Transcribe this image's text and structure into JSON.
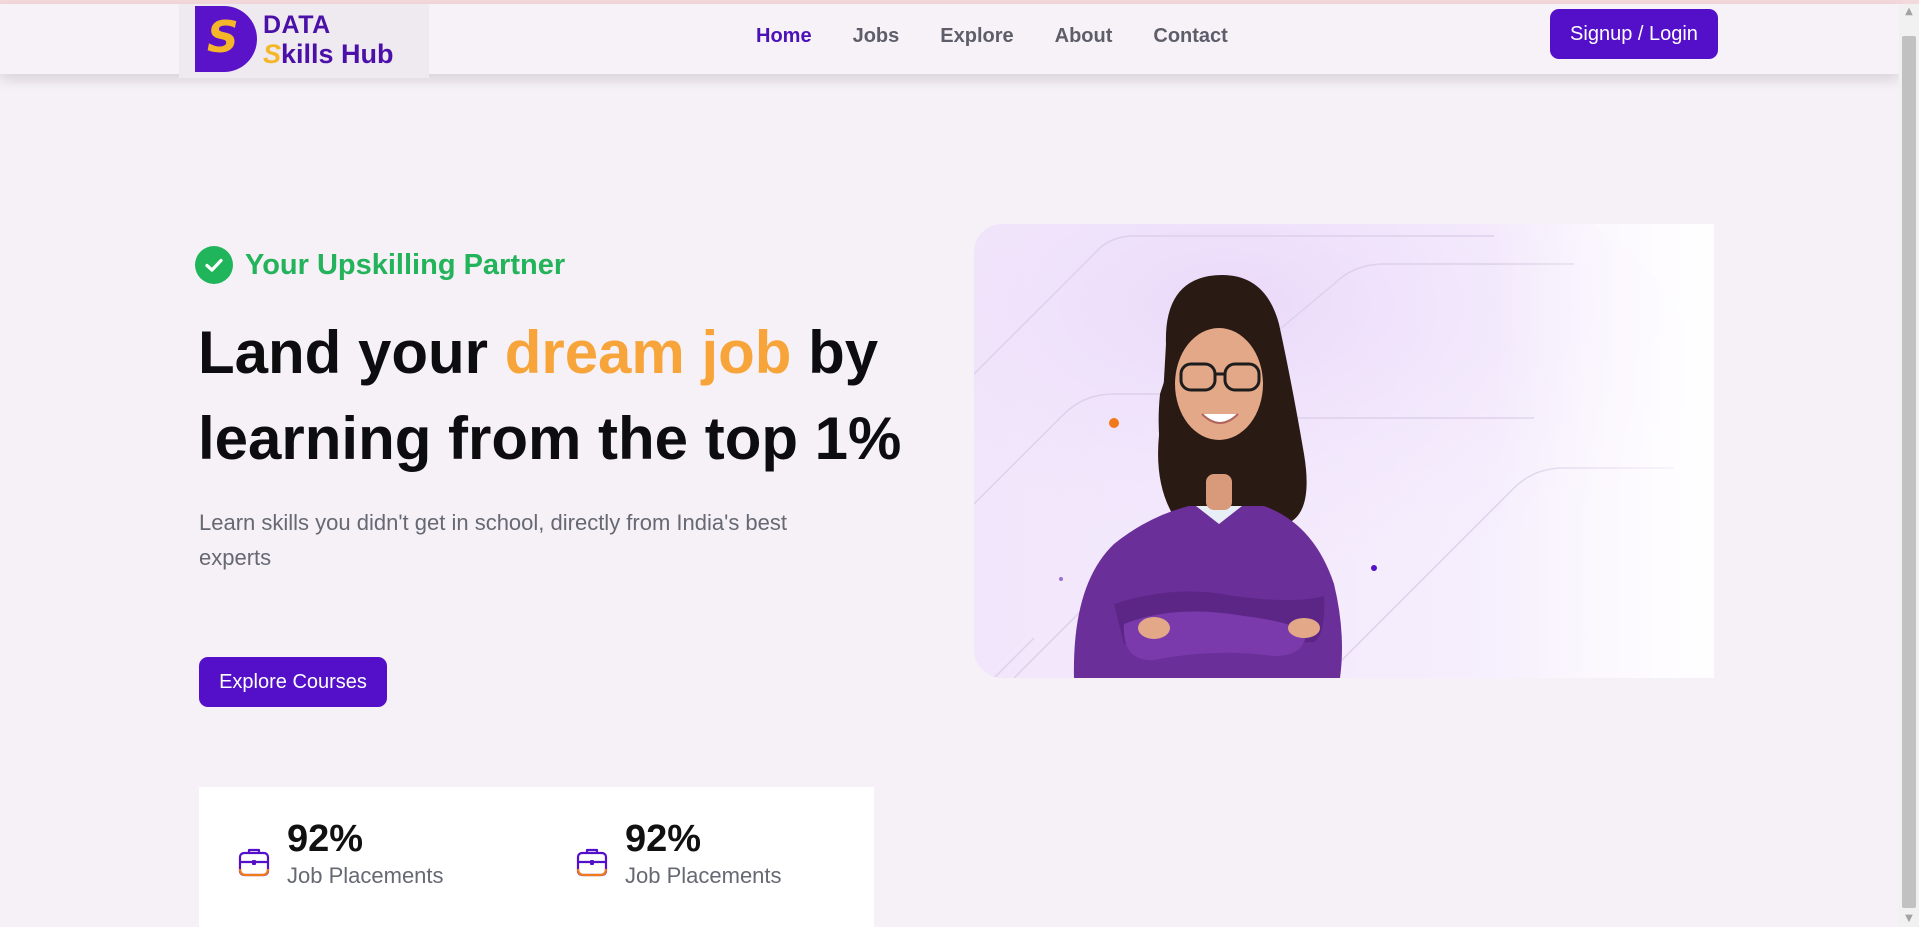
{
  "brand": {
    "logo_mark": "S",
    "name_line1": "DATA",
    "name_line2_first": "S",
    "name_line2_rest": "kills Hub"
  },
  "nav": {
    "items": [
      {
        "label": "Home",
        "active": true
      },
      {
        "label": "Jobs",
        "active": false
      },
      {
        "label": "Explore",
        "active": false
      },
      {
        "label": "About",
        "active": false
      },
      {
        "label": "Contact",
        "active": false
      }
    ],
    "signup_label": "Signup / Login"
  },
  "hero": {
    "tagline": "Your Upskilling Partner",
    "headline_part1": "Land your ",
    "headline_highlight": "dream job",
    "headline_part2": " by learning from the top 1%",
    "subtext": "Learn skills you didn't get in school, directly from India's best experts",
    "cta_label": "Explore Courses"
  },
  "stats": [
    {
      "value": "92%",
      "label": "Job Placements",
      "icon": "briefcase-icon"
    },
    {
      "value": "92%",
      "label": "Job Placements",
      "icon": "briefcase-icon"
    }
  ],
  "colors": {
    "brand_purple": "#5310c8",
    "accent_orange": "#f7a53a",
    "accent_green": "#23b35a",
    "brand_yellow": "#f5b62a"
  }
}
